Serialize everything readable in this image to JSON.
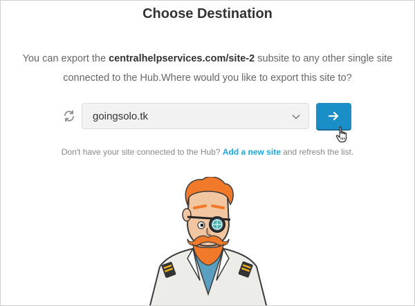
{
  "dialog": {
    "title": "Choose Destination",
    "description": {
      "part1": "You can export the ",
      "site_url": "centralhelpservices.com/site-2",
      "part2": " subsite to any other single site connected to the Hub.Where would you like to export this site to?"
    },
    "select": {
      "value": "goingsolo.tk"
    },
    "hint": {
      "part1": "Don't have your site connected to the Hub? ",
      "link": "Add a new site",
      "part2": " and refresh the list."
    }
  },
  "icons": {
    "refresh": "refresh-icon",
    "chevron": "chevron-down-icon",
    "arrow": "arrow-right-icon",
    "cursor": "hand-cursor-icon"
  },
  "colors": {
    "accent": "#1a8fc7",
    "link": "#17a8e3",
    "title": "#333333",
    "text": "#666666"
  }
}
